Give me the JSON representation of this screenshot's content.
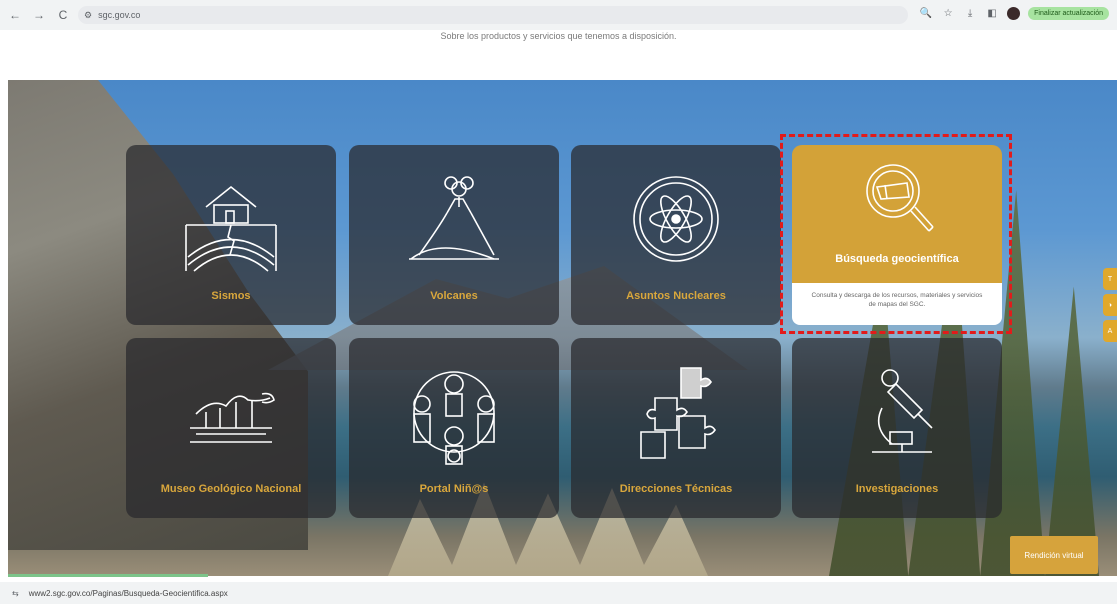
{
  "browser": {
    "back_icon": "←",
    "forward_icon": "→",
    "reload_icon": "C",
    "url": "sgc.gov.co",
    "update_label": "Finalizar actualización"
  },
  "page": {
    "subtitle": "Sobre los productos y servicios que tenemos a disposición."
  },
  "cards": [
    {
      "label": "Sismos",
      "icon": "house-earthquake-icon"
    },
    {
      "label": "Volcanes",
      "icon": "volcano-icon"
    },
    {
      "label": "Asuntos Nucleares",
      "icon": "atom-icon"
    },
    {
      "label": "Búsqueda geocientífica",
      "icon": "magnifier-rock-icon",
      "description": "Consulta y descarga de los recursos, materiales y servicios de mapas del SGC."
    },
    {
      "label": "Museo Geológico Nacional",
      "icon": "fossil-icon"
    },
    {
      "label": "Portal Niñ@s",
      "icon": "children-icon"
    },
    {
      "label": "Direcciones Técnicas",
      "icon": "puzzle-icon"
    },
    {
      "label": "Investigaciones",
      "icon": "microscope-icon"
    }
  ],
  "virtual_button": "Rendición virtual",
  "status_url": "www2.sgc.gov.co/Paginas/Busqueda-Geocientifica.aspx",
  "colors": {
    "accent": "#d3a238",
    "card_text": "#d9a73c",
    "highlight": "#e21b1b"
  }
}
